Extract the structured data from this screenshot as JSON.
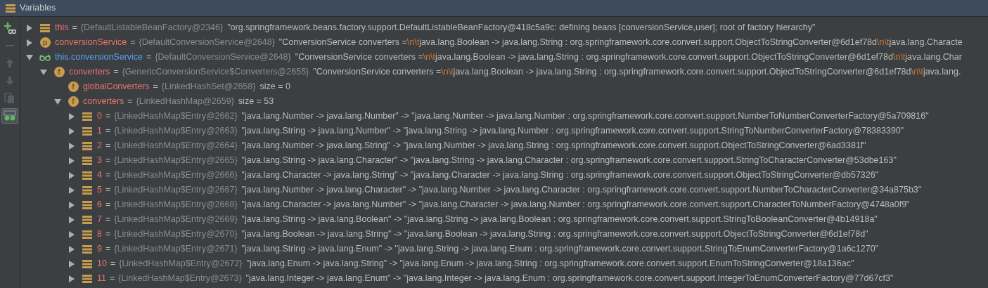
{
  "panel": {
    "title": "Variables"
  },
  "toolbar": [
    {
      "kind": "add-watch",
      "disabled": false,
      "selected": false
    },
    {
      "kind": "remove",
      "disabled": true,
      "selected": false
    },
    {
      "kind": "up",
      "disabled": true,
      "selected": false
    },
    {
      "kind": "down",
      "disabled": true,
      "selected": false
    },
    {
      "kind": "copy",
      "disabled": true,
      "selected": false
    },
    {
      "kind": "watches",
      "disabled": false,
      "selected": true
    }
  ],
  "tree": [
    {
      "kind": "object",
      "equals": "=",
      "name": "this",
      "type": "{DefaultListableBeanFactory@2346}",
      "value": [
        {
          "kind": "text",
          "text": "\"org.springframework.beans.factory.support.DefaultListableBeanFactory@418c5a9c: defining beans [conversionService,user]; root of factory hierarchy\""
        }
      ],
      "expanded": false
    },
    {
      "kind": "field",
      "equals": "=",
      "badge": "p",
      "name": "conversionService",
      "type": "{DefaultConversionService@2648}",
      "value": [
        {
          "kind": "text",
          "text": "\"ConversionService converters ="
        },
        {
          "kind": "escape",
          "text": "\\n\\t"
        },
        {
          "kind": "text",
          "text": "java.lang.Boolean -> java.lang.String : org.springframework.core.convert.support.ObjectToStringConverter@6d1ef78d"
        },
        {
          "kind": "escape",
          "text": "\\n\\t"
        },
        {
          "kind": "text",
          "text": "java.lang.Characte"
        }
      ],
      "expanded": false
    },
    {
      "kind": "watch",
      "equals": "=",
      "name": "this.conversionService",
      "type": "{DefaultConversionService@2648}",
      "value": [
        {
          "kind": "text",
          "text": "\"ConversionService converters ="
        },
        {
          "kind": "escape",
          "text": "\\n\\t"
        },
        {
          "kind": "text",
          "text": "java.lang.Boolean -> java.lang.String : org.springframework.core.convert.support.ObjectToStringConverter@6d1ef78d"
        },
        {
          "kind": "escape",
          "text": "\\n\\t"
        },
        {
          "kind": "text",
          "text": "java.lang.Char"
        }
      ],
      "expanded": true,
      "children": [
        {
          "kind": "field",
          "equals": "=",
          "badge": "f",
          "name": "converters",
          "type": "{GenericConversionService$Converters@2655}",
          "value": [
            {
              "kind": "text",
              "text": "\"ConversionService converters ="
            },
            {
              "kind": "escape",
              "text": "\\n\\t"
            },
            {
              "kind": "text",
              "text": "java.lang.Boolean -> java.lang.String : org.springframework.core.convert.support.ObjectToStringConverter@6d1ef78d"
            },
            {
              "kind": "escape",
              "text": "\\n\\t"
            },
            {
              "kind": "text",
              "text": "java.lang."
            }
          ],
          "expanded": true,
          "children": [
            {
              "kind": "field",
              "equals": "=",
              "badge": "f",
              "name": "globalConverters",
              "type": "{LinkedHashSet@2658}",
              "size": "size = 0"
            },
            {
              "kind": "field",
              "equals": "=",
              "badge": "f",
              "name": "converters",
              "type": "{LinkedHashMap@2659}",
              "size": "size = 53",
              "expanded": true,
              "children": [
                {
                  "kind": "object",
                  "equals": "=",
                  "name": "0",
                  "type": "{LinkedHashMap$Entry@2662}",
                  "value": [
                    {
                      "kind": "text",
                      "text": "\"java.lang.Number -> java.lang.Number\" -> \"java.lang.Number -> java.lang.Number : org.springframework.core.convert.support.NumberToNumberConverterFactory@5a709816\""
                    }
                  ],
                  "expanded": false
                },
                {
                  "kind": "object",
                  "equals": "=",
                  "name": "1",
                  "type": "{LinkedHashMap$Entry@2663}",
                  "value": [
                    {
                      "kind": "text",
                      "text": "\"java.lang.String -> java.lang.Number\" -> \"java.lang.String -> java.lang.Number : org.springframework.core.convert.support.StringToNumberConverterFactory@78383390\""
                    }
                  ],
                  "expanded": false
                },
                {
                  "kind": "object",
                  "equals": "=",
                  "name": "2",
                  "type": "{LinkedHashMap$Entry@2664}",
                  "value": [
                    {
                      "kind": "text",
                      "text": "\"java.lang.Number -> java.lang.String\" -> \"java.lang.Number -> java.lang.String : org.springframework.core.convert.support.ObjectToStringConverter@6ad3381f\""
                    }
                  ],
                  "expanded": false
                },
                {
                  "kind": "object",
                  "equals": "=",
                  "name": "3",
                  "type": "{LinkedHashMap$Entry@2665}",
                  "value": [
                    {
                      "kind": "text",
                      "text": "\"java.lang.String -> java.lang.Character\" -> \"java.lang.String -> java.lang.Character : org.springframework.core.convert.support.StringToCharacterConverter@53dbe163\""
                    }
                  ],
                  "expanded": false
                },
                {
                  "kind": "object",
                  "equals": "=",
                  "name": "4",
                  "type": "{LinkedHashMap$Entry@2666}",
                  "value": [
                    {
                      "kind": "text",
                      "text": "\"java.lang.Character -> java.lang.String\" -> \"java.lang.Character -> java.lang.String : org.springframework.core.convert.support.ObjectToStringConverter@db57326\""
                    }
                  ],
                  "expanded": false
                },
                {
                  "kind": "object",
                  "equals": "=",
                  "name": "5",
                  "type": "{LinkedHashMap$Entry@2667}",
                  "value": [
                    {
                      "kind": "text",
                      "text": "\"java.lang.Number -> java.lang.Character\" -> \"java.lang.Number -> java.lang.Character : org.springframework.core.convert.support.NumberToCharacterConverter@34a875b3\""
                    }
                  ],
                  "expanded": false
                },
                {
                  "kind": "object",
                  "equals": "=",
                  "name": "6",
                  "type": "{LinkedHashMap$Entry@2668}",
                  "value": [
                    {
                      "kind": "text",
                      "text": "\"java.lang.Character -> java.lang.Number\" -> \"java.lang.Character -> java.lang.Number : org.springframework.core.convert.support.CharacterToNumberFactory@4748a0f9\""
                    }
                  ],
                  "expanded": false
                },
                {
                  "kind": "object",
                  "equals": "=",
                  "name": "7",
                  "type": "{LinkedHashMap$Entry@2669}",
                  "value": [
                    {
                      "kind": "text",
                      "text": "\"java.lang.String -> java.lang.Boolean\" -> \"java.lang.String -> java.lang.Boolean : org.springframework.core.convert.support.StringToBooleanConverter@4b14918a\""
                    }
                  ],
                  "expanded": false
                },
                {
                  "kind": "object",
                  "equals": "=",
                  "name": "8",
                  "type": "{LinkedHashMap$Entry@2670}",
                  "value": [
                    {
                      "kind": "text",
                      "text": "\"java.lang.Boolean -> java.lang.String\" -> \"java.lang.Boolean -> java.lang.String : org.springframework.core.convert.support.ObjectToStringConverter@6d1ef78d\""
                    }
                  ],
                  "expanded": false
                },
                {
                  "kind": "object",
                  "equals": "=",
                  "name": "9",
                  "type": "{LinkedHashMap$Entry@2671}",
                  "value": [
                    {
                      "kind": "text",
                      "text": "\"java.lang.String -> java.lang.Enum\" -> \"java.lang.String -> java.lang.Enum : org.springframework.core.convert.support.StringToEnumConverterFactory@1a6c1270\""
                    }
                  ],
                  "expanded": false
                },
                {
                  "kind": "object",
                  "equals": "=",
                  "name": "10",
                  "type": "{LinkedHashMap$Entry@2672}",
                  "value": [
                    {
                      "kind": "text",
                      "text": "\"java.lang.Enum -> java.lang.String\" -> \"java.lang.Enum -> java.lang.String : org.springframework.core.convert.support.EnumToStringConverter@18a136ac\""
                    }
                  ],
                  "expanded": false
                },
                {
                  "kind": "object",
                  "equals": "=",
                  "name": "11",
                  "type": "{LinkedHashMap$Entry@2673}",
                  "value": [
                    {
                      "kind": "text",
                      "text": "\"java.lang.Integer -> java.lang.Enum\" -> \"java.lang.Integer -> java.lang.Enum : org.springframework.core.convert.support.IntegerToEnumConverterFactory@77d67cf3\""
                    }
                  ],
                  "expanded": false
                }
              ]
            }
          ]
        }
      ]
    }
  ]
}
